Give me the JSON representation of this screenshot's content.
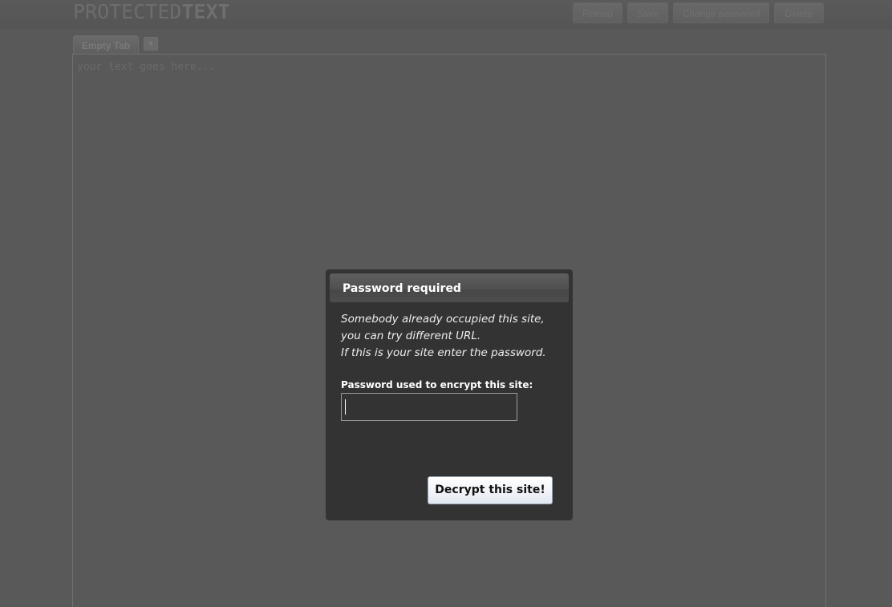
{
  "header": {
    "logo_light": "PROTECTED",
    "logo_bold": "TEXT",
    "buttons": {
      "reload": "Reload",
      "save": "Save",
      "change_password": "Change password",
      "delete": "Delete"
    }
  },
  "tabs": {
    "items": [
      {
        "label": "Empty Tab"
      }
    ],
    "add_label": "+"
  },
  "editor": {
    "placeholder": "your text goes here..."
  },
  "modal": {
    "title": "Password required",
    "message_lines": [
      "Somebody already occupied this site,",
      "you can try different URL.",
      "If this is your site enter the password."
    ],
    "password_label": "Password used to encrypt this site:",
    "password_value": "",
    "submit_label": "Decrypt this site!"
  },
  "colors": {
    "overlay_background": "#595959",
    "modal_background": "#333333",
    "button_background": "#f3f5f9"
  }
}
